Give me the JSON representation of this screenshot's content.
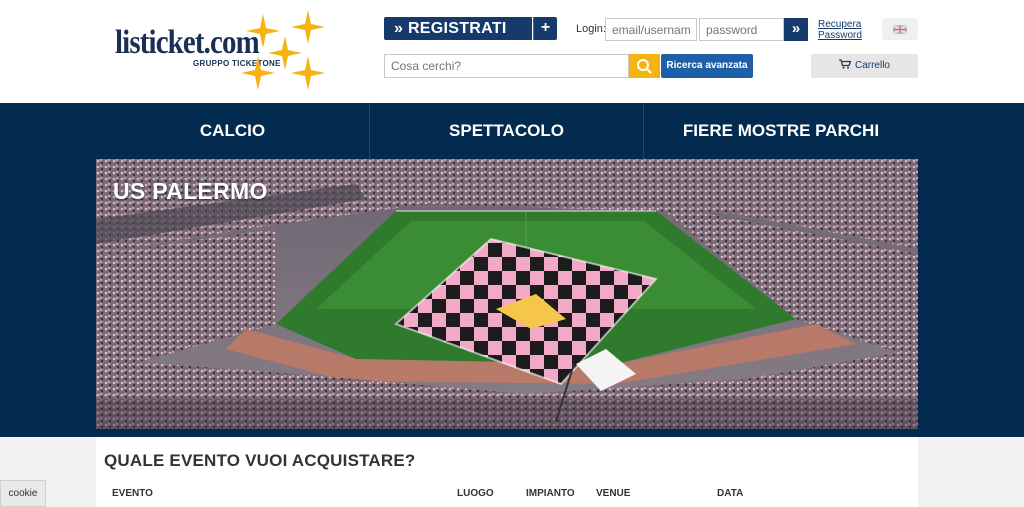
{
  "header": {
    "logo_text": "listicket.com",
    "logo_sub": "GRUPPO TICKETONE",
    "register_label": "» REGISTRATI",
    "register_plus": "+",
    "login_label": "Login:",
    "email_placeholder": "email/username",
    "password_placeholder": "password",
    "login_go": "»",
    "recover_line1": "Recupera",
    "recover_line2": "Password",
    "search_placeholder": "Cosa cerchi?",
    "advanced_search_label": "Ricerca avanzata",
    "cart_label": "Carrello",
    "cart_icon": "cart-icon",
    "language_icon": "uk-flag-icon"
  },
  "nav": {
    "items": [
      {
        "label": "CALCIO"
      },
      {
        "label": "SPETTACOLO"
      },
      {
        "label": "FIERE MOSTRE PARCHI"
      }
    ]
  },
  "hero": {
    "title": "US PALERMO"
  },
  "content": {
    "section_title": "QUALE EVENTO VUOI ACQUISTARE?",
    "columns": [
      "EVENTO",
      "LUOGO",
      "IMPIANTO",
      "VENUE",
      "DATA"
    ]
  },
  "cookie_label": "cookie",
  "colors": {
    "navy": "#032b50",
    "button_navy": "#163a6b",
    "accent_yellow": "#f5b312",
    "link_blue": "#1f5fa8",
    "palermo_pink": "#f2a7c8"
  }
}
